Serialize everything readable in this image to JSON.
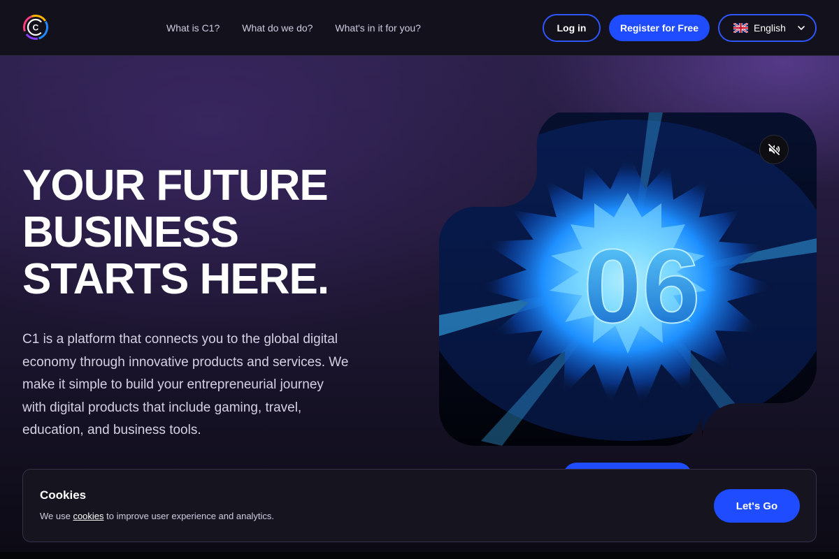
{
  "header": {
    "logo_text": "C",
    "nav": [
      {
        "label": "What is C1?"
      },
      {
        "label": "What do we do?"
      },
      {
        "label": "What's in it for you?"
      }
    ],
    "login_label": "Log in",
    "register_label": "Register for Free",
    "language": {
      "label": "English",
      "flag": "uk-flag-icon"
    }
  },
  "hero": {
    "title_lines": [
      "YOUR FUTURE",
      "BUSINESS",
      "STARTS HERE."
    ],
    "description_lines": [
      "C1 is a platform that connects you to the global digital",
      "economy through innovative products and services. We",
      "make it simple to build your entrepreneurial journey",
      "with digital products that include gaming, travel,",
      "education, and business tools."
    ]
  },
  "video": {
    "overlay_text": "06",
    "mute_icon": "volume-muted-icon",
    "colors": {
      "glow": "#1e8fff",
      "core": "#7fe0ff",
      "bg": "#03050f"
    }
  },
  "cookies": {
    "title": "Cookies",
    "text_before": "We use ",
    "link_label": "cookies",
    "text_after": " to improve user experience and analytics.",
    "accept_label": "Let's Go"
  },
  "colors": {
    "accent": "#1f4cff",
    "header_bg": "#12111c"
  }
}
